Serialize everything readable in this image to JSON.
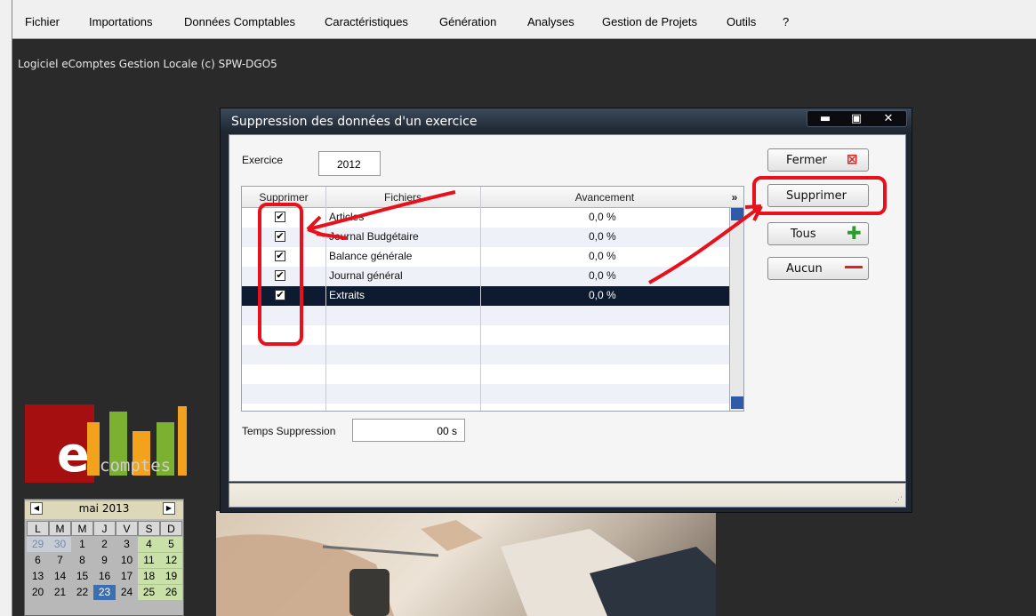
{
  "menubar": {
    "items": [
      {
        "label": "Fichier"
      },
      {
        "label": "Importations"
      },
      {
        "label": "Données Comptables"
      },
      {
        "label": "Caractéristiques"
      },
      {
        "label": "Génération"
      },
      {
        "label": "Analyses"
      },
      {
        "label": "Gestion de Projets"
      },
      {
        "label": "Outils"
      },
      {
        "label": "?"
      }
    ]
  },
  "app_caption": "Logiciel eComptes Gestion Locale (c) SPW-DGO5",
  "logo": {
    "letter": "e",
    "word": "comptes"
  },
  "calendar": {
    "month": "mai 2013",
    "prev_icon": "left-arrow-icon",
    "next_icon": "right-arrow-icon",
    "day_headers": [
      "L",
      "M",
      "M",
      "J",
      "V",
      "S",
      "D"
    ],
    "weeks": [
      [
        "29",
        "30",
        "1",
        "2",
        "3",
        "4",
        "5"
      ],
      [
        "6",
        "7",
        "8",
        "9",
        "10",
        "11",
        "12"
      ],
      [
        "13",
        "14",
        "15",
        "16",
        "17",
        "18",
        "19"
      ],
      [
        "20",
        "21",
        "22",
        "23",
        "24",
        "25",
        "26"
      ]
    ],
    "today": "23",
    "colors": {
      "weekend": "#c9e0a8",
      "today": "#3b6fb0"
    }
  },
  "dialog": {
    "title": "Suppression des données d'un exercice",
    "window_buttons": [
      "minimize-icon",
      "maximize-icon",
      "close-icon"
    ],
    "exercice_label": "Exercice",
    "exercice_value": "2012",
    "grid": {
      "headers": [
        "Supprimer",
        "Fichiers",
        "Avancement"
      ],
      "rows": [
        {
          "checked": true,
          "fichier": "Articles",
          "avancement": "0,0 %"
        },
        {
          "checked": true,
          "fichier": "Journal Budgétaire",
          "avancement": "0,0 %"
        },
        {
          "checked": true,
          "fichier": "Balance générale",
          "avancement": "0,0 %"
        },
        {
          "checked": true,
          "fichier": "Journal général",
          "avancement": "0,0 %"
        },
        {
          "checked": true,
          "fichier": "Extraits",
          "avancement": "0,0 %"
        }
      ],
      "selected_row": "Extraits"
    },
    "temps_label": "Temps Suppression",
    "temps_value": "00 s",
    "buttons": {
      "fermer": "Fermer",
      "supprimer": "Supprimer",
      "tous": "Tous",
      "aucun": "Aucun"
    },
    "colors": {
      "annotation": "#e8101a",
      "selected_row": "#0e1a30"
    }
  }
}
